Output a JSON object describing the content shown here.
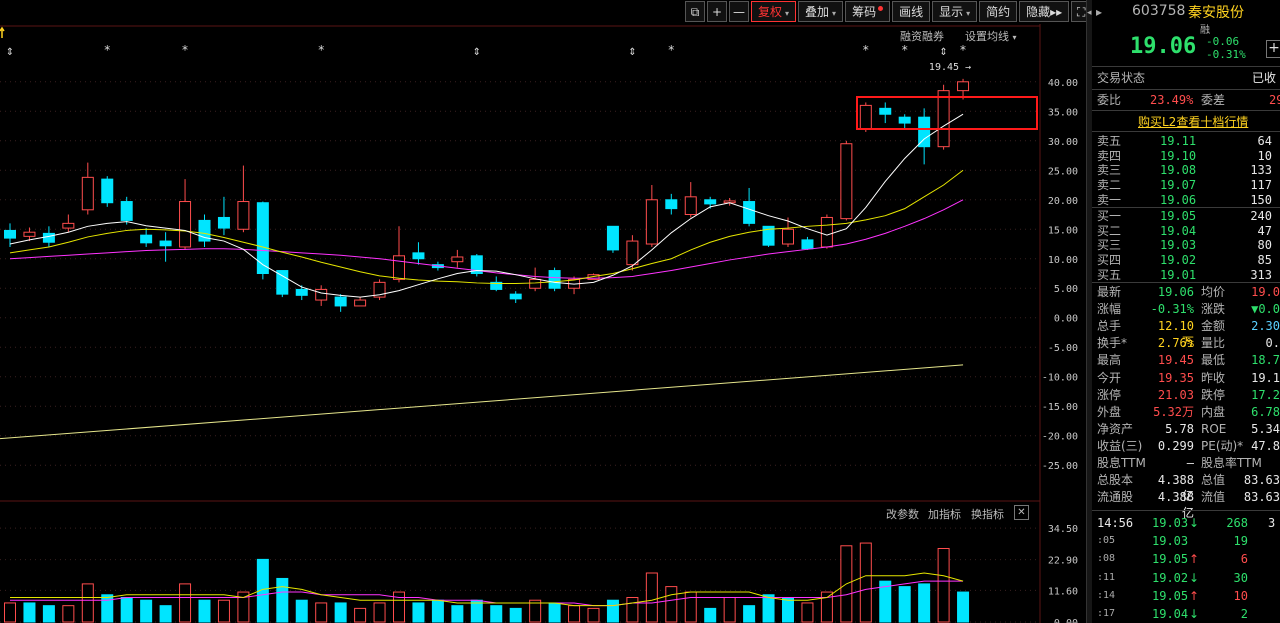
{
  "toolbar": {
    "items": [
      {
        "label": "⧉",
        "kind": "icon"
      },
      {
        "label": "+",
        "kind": "icon"
      },
      {
        "label": "—",
        "kind": "icon"
      },
      {
        "label": "复权",
        "active": true,
        "arrow": true
      },
      {
        "label": "叠加",
        "arrow": true
      },
      {
        "label": "筹码",
        "dot": true
      },
      {
        "label": "画线"
      },
      {
        "label": "显示",
        "arrow": true
      },
      {
        "label": "简约"
      },
      {
        "label": "隐藏▸▸"
      },
      {
        "label": "⛶",
        "kind": "icon"
      }
    ]
  },
  "chart_header": {
    "margin_trading": "融资融券",
    "ma_settings": "设置均线",
    "high_marker": "19.45",
    "star": "*",
    "arrow_mark": "⇕"
  },
  "volume_header": {
    "modify": "改参数",
    "add": "加指标",
    "switch": "换指标",
    "close": "✕"
  },
  "chart_data": {
    "type": "candlestick",
    "y_axis_ticks": [
      "40.00",
      "35.00",
      "30.00",
      "25.00",
      "20.00",
      "15.00",
      "10.00",
      "5.00",
      "0.00",
      "-5.00",
      "-10.00",
      "-15.00",
      "-20.00",
      "-25.00"
    ],
    "ylim": [
      -27,
      42
    ],
    "volume_axis_ticks": [
      "34.50",
      "22.90",
      "11.60",
      "0.00"
    ],
    "volume_ylim": [
      0,
      36
    ],
    "colors": {
      "up": "#ff4d4d",
      "down": "#00e5ff",
      "ma5": "#ffffff",
      "ma10": "#e6e600",
      "ma20": "#ff33ff",
      "long_ma": "#e6e68c"
    },
    "candles": [
      {
        "o": 14.8,
        "c": 13.5,
        "h": 16.0,
        "l": 12.0
      },
      {
        "o": 13.8,
        "c": 14.5,
        "h": 15.3,
        "l": 13.0
      },
      {
        "o": 14.3,
        "c": 12.8,
        "h": 15.5,
        "l": 12.0
      },
      {
        "o": 15.2,
        "c": 16.0,
        "h": 17.5,
        "l": 14.5
      },
      {
        "o": 18.3,
        "c": 23.8,
        "h": 26.3,
        "l": 17.5
      },
      {
        "o": 23.5,
        "c": 19.5,
        "h": 24.0,
        "l": 18.8
      },
      {
        "o": 19.7,
        "c": 16.5,
        "h": 20.5,
        "l": 15.8
      },
      {
        "o": 14.0,
        "c": 12.7,
        "h": 15.2,
        "l": 12.0
      },
      {
        "o": 13.0,
        "c": 12.2,
        "h": 14.5,
        "l": 9.5
      },
      {
        "o": 12.0,
        "c": 19.7,
        "h": 23.5,
        "l": 11.5
      },
      {
        "o": 16.5,
        "c": 13.0,
        "h": 17.5,
        "l": 12.0
      },
      {
        "o": 17.0,
        "c": 15.2,
        "h": 20.5,
        "l": 14.0
      },
      {
        "o": 15.0,
        "c": 19.7,
        "h": 25.8,
        "l": 14.5
      },
      {
        "o": 19.5,
        "c": 7.5,
        "h": 19.7,
        "l": 6.5
      },
      {
        "o": 8.0,
        "c": 4.0,
        "h": 8.0,
        "l": 3.5
      },
      {
        "o": 4.8,
        "c": 3.8,
        "h": 5.5,
        "l": 3.0
      },
      {
        "o": 3.0,
        "c": 4.8,
        "h": 5.5,
        "l": 2.0
      },
      {
        "o": 3.5,
        "c": 2.0,
        "h": 4.0,
        "l": 1.0
      },
      {
        "o": 2.0,
        "c": 3.0,
        "h": 3.5,
        "l": 2.0
      },
      {
        "o": 3.5,
        "c": 6.0,
        "h": 6.5,
        "l": 3.0
      },
      {
        "o": 6.5,
        "c": 10.5,
        "h": 15.5,
        "l": 6.0
      },
      {
        "o": 11.0,
        "c": 10.0,
        "h": 12.8,
        "l": 9.0
      },
      {
        "o": 9.0,
        "c": 8.5,
        "h": 9.5,
        "l": 8.0
      },
      {
        "o": 9.5,
        "c": 10.3,
        "h": 11.5,
        "l": 8.5
      },
      {
        "o": 10.5,
        "c": 7.5,
        "h": 10.8,
        "l": 7.0
      },
      {
        "o": 6.0,
        "c": 4.8,
        "h": 7.0,
        "l": 4.5
      },
      {
        "o": 4.0,
        "c": 3.2,
        "h": 4.5,
        "l": 2.5
      },
      {
        "o": 5.0,
        "c": 6.5,
        "h": 8.5,
        "l": 4.5
      },
      {
        "o": 8.0,
        "c": 5.0,
        "h": 8.5,
        "l": 4.5
      },
      {
        "o": 5.0,
        "c": 6.5,
        "h": 7.0,
        "l": 4.0
      },
      {
        "o": 6.5,
        "c": 7.3,
        "h": 7.5,
        "l": 6.5
      },
      {
        "o": 15.5,
        "c": 11.5,
        "h": 15.5,
        "l": 11.0
      },
      {
        "o": 9.0,
        "c": 13.0,
        "h": 14.0,
        "l": 8.0
      },
      {
        "o": 12.5,
        "c": 20.0,
        "h": 22.5,
        "l": 12.0
      },
      {
        "o": 20.0,
        "c": 18.5,
        "h": 21.0,
        "l": 17.5
      },
      {
        "o": 17.5,
        "c": 20.5,
        "h": 23.0,
        "l": 17.0
      },
      {
        "o": 20.0,
        "c": 19.3,
        "h": 20.5,
        "l": 18.5
      },
      {
        "o": 19.5,
        "c": 19.8,
        "h": 20.3,
        "l": 19.0
      },
      {
        "o": 19.7,
        "c": 16.0,
        "h": 22.0,
        "l": 15.5
      },
      {
        "o": 15.5,
        "c": 12.3,
        "h": 15.5,
        "l": 12.0
      },
      {
        "o": 12.5,
        "c": 15.0,
        "h": 17.0,
        "l": 12.0
      },
      {
        "o": 13.2,
        "c": 11.7,
        "h": 13.7,
        "l": 11.5
      },
      {
        "o": 12.0,
        "c": 17.0,
        "h": 17.5,
        "l": 11.7
      },
      {
        "o": 16.8,
        "c": 29.5,
        "h": 30.0,
        "l": 16.5
      },
      {
        "o": 32.0,
        "c": 36.0,
        "h": 36.5,
        "l": 31.5
      },
      {
        "o": 35.5,
        "c": 34.5,
        "h": 36.5,
        "l": 33.0
      },
      {
        "o": 34.0,
        "c": 33.0,
        "h": 34.5,
        "l": 32.0
      },
      {
        "o": 34.0,
        "c": 29.0,
        "h": 35.5,
        "l": 26.0
      },
      {
        "o": 29.0,
        "c": 38.5,
        "h": 39.5,
        "l": 28.5
      },
      {
        "o": 38.5,
        "c": 40.0,
        "h": 40.5,
        "l": 37.0
      }
    ],
    "ma5": [
      12.5,
      13.2,
      13.8,
      14.5,
      15.5,
      16.0,
      16.3,
      15.6,
      15.2,
      14.8,
      13.6,
      13.0,
      11.6,
      9.0,
      7.1,
      5.2,
      4.2,
      3.8,
      3.5,
      3.9,
      4.6,
      5.6,
      6.6,
      7.5,
      8.0,
      7.9,
      7.3,
      6.6,
      6.0,
      5.7,
      6.0,
      7.2,
      8.8,
      11.5,
      14.4,
      16.8,
      18.8,
      19.5,
      18.4,
      17.3,
      16.4,
      15.1,
      14.0,
      15.1,
      18.7,
      23.1,
      27.0,
      30.3,
      32.5,
      34.5
    ],
    "ma10": [
      11.0,
      11.5,
      12.0,
      12.8,
      13.7,
      14.3,
      14.8,
      15.0,
      14.9,
      14.7,
      14.3,
      13.6,
      12.8,
      12.0,
      11.1,
      10.3,
      9.4,
      8.6,
      7.8,
      7.1,
      6.7,
      6.4,
      6.2,
      6.1,
      5.9,
      5.8,
      5.8,
      5.9,
      6.1,
      6.4,
      7.0,
      7.5,
      8.3,
      9.2,
      10.0,
      11.5,
      12.8,
      13.8,
      14.5,
      15.0,
      15.2,
      15.5,
      15.7,
      16.0,
      16.6,
      17.3,
      18.5,
      20.5,
      22.5,
      25.0
    ],
    "ma20": [
      10.0,
      10.2,
      10.4,
      10.6,
      10.8,
      11.0,
      11.2,
      11.4,
      11.5,
      11.6,
      11.7,
      11.7,
      11.6,
      11.4,
      11.2,
      11.0,
      10.8,
      10.6,
      10.3,
      10.0,
      9.6,
      9.2,
      8.8,
      8.4,
      8.0,
      7.6,
      7.3,
      7.0,
      6.8,
      6.7,
      6.7,
      6.8,
      7.0,
      7.5,
      8.0,
      8.6,
      9.2,
      9.8,
      10.3,
      10.8,
      11.2,
      11.6,
      12.0,
      12.5,
      13.3,
      14.3,
      15.5,
      16.8,
      18.3,
      20.0
    ],
    "long_ma_start": -20.5,
    "long_ma_end": -8.0,
    "volumes": [
      [
        7,
        "u"
      ],
      [
        7,
        "d"
      ],
      [
        6,
        "d"
      ],
      [
        6,
        "u"
      ],
      [
        14,
        "u"
      ],
      [
        10,
        "d"
      ],
      [
        9,
        "d"
      ],
      [
        8,
        "d"
      ],
      [
        6,
        "d"
      ],
      [
        14,
        "u"
      ],
      [
        8,
        "d"
      ],
      [
        8,
        "u"
      ],
      [
        11,
        "u"
      ],
      [
        23,
        "d"
      ],
      [
        16,
        "d"
      ],
      [
        8,
        "d"
      ],
      [
        7,
        "u"
      ],
      [
        7,
        "d"
      ],
      [
        5,
        "u"
      ],
      [
        7,
        "u"
      ],
      [
        11,
        "u"
      ],
      [
        7,
        "d"
      ],
      [
        8,
        "d"
      ],
      [
        6,
        "d"
      ],
      [
        8,
        "d"
      ],
      [
        6,
        "d"
      ],
      [
        5,
        "d"
      ],
      [
        8,
        "u"
      ],
      [
        7,
        "d"
      ],
      [
        6,
        "u"
      ],
      [
        5,
        "u"
      ],
      [
        8,
        "d"
      ],
      [
        9,
        "u"
      ],
      [
        18,
        "u"
      ],
      [
        13,
        "u"
      ],
      [
        11,
        "u"
      ],
      [
        5,
        "d"
      ],
      [
        9,
        "u"
      ],
      [
        6,
        "d"
      ],
      [
        10,
        "d"
      ],
      [
        9,
        "d"
      ],
      [
        7,
        "u"
      ],
      [
        11,
        "u"
      ],
      [
        28,
        "u"
      ],
      [
        29,
        "u"
      ],
      [
        15,
        "d"
      ],
      [
        13,
        "d"
      ],
      [
        14,
        "d"
      ],
      [
        27,
        "u"
      ],
      [
        11,
        "d"
      ]
    ],
    "vol_ma5": [
      9,
      9,
      9,
      9,
      9,
      9,
      10,
      10,
      10,
      10,
      10,
      10,
      9,
      12,
      13,
      12,
      10,
      9,
      8,
      8,
      8,
      8,
      8,
      7,
      7,
      7,
      7,
      7,
      7,
      6,
      6,
      6,
      7,
      8,
      10,
      11,
      11,
      11,
      11,
      9,
      8,
      8,
      9,
      14,
      17,
      17,
      17,
      18,
      17,
      15
    ],
    "vol_ma10": [
      8,
      8,
      8,
      8,
      8,
      8,
      9,
      9,
      9,
      9,
      9,
      9,
      9,
      10,
      11,
      11,
      10,
      10,
      10,
      10,
      9,
      9,
      8,
      8,
      8,
      7,
      7,
      7,
      7,
      7,
      6,
      6,
      7,
      7,
      8,
      9,
      9,
      9,
      9,
      9,
      9,
      9,
      9,
      10,
      12,
      13,
      14,
      15,
      15,
      15
    ]
  },
  "panel": {
    "code": "603758",
    "name": "秦安股份",
    "badge": "融",
    "price": "19.06",
    "change": "-0.06",
    "change_pct": "-0.31%",
    "add_btn": "+",
    "trade_status_label": "交易状态",
    "trade_status_value": "已收",
    "weibi_label": "委比",
    "weibi_value": "23.49%",
    "weicha_label": "委差",
    "weicha_value": "29",
    "buy_l2": "购买L2查看十档行情",
    "asks": [
      {
        "label": "卖五",
        "price": "19.11",
        "vol": "64"
      },
      {
        "label": "卖四",
        "price": "19.10",
        "vol": "10"
      },
      {
        "label": "卖三",
        "price": "19.08",
        "vol": "133"
      },
      {
        "label": "卖二",
        "price": "19.07",
        "vol": "117"
      },
      {
        "label": "卖一",
        "price": "19.06",
        "vol": "150"
      }
    ],
    "bids": [
      {
        "label": "买一",
        "price": "19.05",
        "vol": "240"
      },
      {
        "label": "买二",
        "price": "19.04",
        "vol": "47"
      },
      {
        "label": "买三",
        "price": "19.03",
        "vol": "80"
      },
      {
        "label": "买四",
        "price": "19.02",
        "vol": "85"
      },
      {
        "label": "买五",
        "price": "19.01",
        "vol": "313"
      }
    ],
    "stats": [
      {
        "l1": "最新",
        "v1": "19.06",
        "c1": "green",
        "l2": "均价",
        "v2": "19.0",
        "c2": "red"
      },
      {
        "l1": "涨幅",
        "v1": "-0.31%",
        "c1": "green",
        "l2": "涨跌",
        "v2": "▼0.0",
        "c2": "green"
      },
      {
        "l1": "总手",
        "v1": "12.10万",
        "c1": "yel",
        "l2": "金额",
        "v2": "2.30",
        "c2": "cyan"
      },
      {
        "l1": "换手*",
        "v1": "2.76%",
        "c1": "yel",
        "l2": "量比",
        "v2": "0.",
        "c2": "wht"
      },
      {
        "l1": "最高",
        "v1": "19.45",
        "c1": "red",
        "l2": "最低",
        "v2": "18.7",
        "c2": "green"
      },
      {
        "l1": "今开",
        "v1": "19.35",
        "c1": "red",
        "l2": "昨收",
        "v2": "19.1",
        "c2": "wht"
      },
      {
        "l1": "涨停",
        "v1": "21.03",
        "c1": "red",
        "l2": "跌停",
        "v2": "17.2",
        "c2": "green"
      },
      {
        "l1": "外盘",
        "v1": "5.32万",
        "c1": "red",
        "l2": "内盘",
        "v2": "6.78",
        "c2": "green"
      },
      {
        "l1": "净资产",
        "v1": "5.78",
        "c1": "wht",
        "l2": "ROE",
        "v2": "5.34",
        "c2": "wht"
      },
      {
        "l1": "收益(三)",
        "v1": "0.299",
        "c1": "wht",
        "l2": "PE(动)*",
        "v2": "47.8",
        "c2": "wht"
      },
      {
        "l1": "股息TTM",
        "v1": "—",
        "c1": "wht",
        "l2": "股息率TTM",
        "v2": "",
        "c2": "wht"
      },
      {
        "l1": "总股本",
        "v1": "4.388亿",
        "c1": "wht",
        "l2": "总值",
        "v2": "83.63",
        "c2": "wht"
      },
      {
        "l1": "流通股",
        "v1": "4.388亿",
        "c1": "wht",
        "l2": "流值",
        "v2": "83.63",
        "c2": "wht"
      }
    ],
    "ticks": [
      {
        "t": "14:56",
        "p": "19.03",
        "dir": "↓",
        "v": "268",
        "extra": "3"
      },
      {
        "t": ":05",
        "p": "19.03",
        "dir": "",
        "v": "19",
        "extra": ""
      },
      {
        "t": ":08",
        "p": "19.05",
        "dir": "↑",
        "v": "6",
        "extra": ""
      },
      {
        "t": ":11",
        "p": "19.02",
        "dir": "↓",
        "v": "30",
        "extra": ""
      },
      {
        "t": ":14",
        "p": "19.05",
        "dir": "↑",
        "v": "10",
        "extra": ""
      },
      {
        "t": ":17",
        "p": "19.04",
        "dir": "↓",
        "v": "2",
        "extra": ""
      }
    ]
  }
}
